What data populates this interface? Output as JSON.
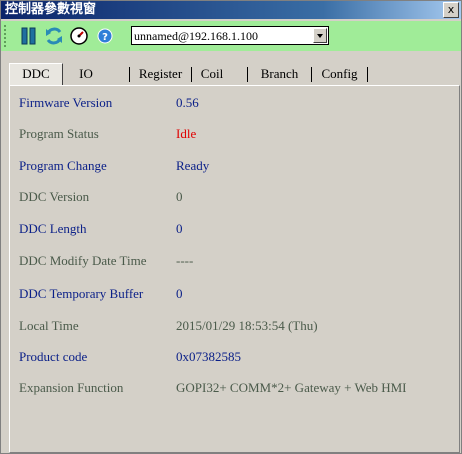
{
  "window": {
    "title": "控制器參數視窗",
    "close_label": "x"
  },
  "toolbar": {
    "icons": [
      "pause-icon",
      "refresh-icon",
      "gauge-icon",
      "help-icon"
    ],
    "connection": {
      "selected": "unnamed@192.168.1.100"
    }
  },
  "tabs": [
    {
      "label": "DDC"
    },
    {
      "label": "IO"
    },
    {
      "label": "Register"
    },
    {
      "label": "Coil"
    },
    {
      "label": "Branch"
    },
    {
      "label": "Config"
    }
  ],
  "fields": [
    {
      "label": "Firmware Version",
      "value": "0.56",
      "label_color": "blue",
      "value_color": "dark"
    },
    {
      "label": "Program Status",
      "value": "Idle",
      "label_color": "gray",
      "value_color": "red"
    },
    {
      "label": "Program Change",
      "value": "Ready",
      "label_color": "blue",
      "value_color": "dark"
    },
    {
      "label": "DDC Version",
      "value": "0",
      "label_color": "gray",
      "value_color": "gray"
    },
    {
      "label": "DDC Length",
      "value": "0",
      "label_color": "blue",
      "value_color": "dark"
    },
    {
      "label": "DDC Modify Date Time",
      "value": "----",
      "label_color": "gray",
      "value_color": "gray"
    },
    {
      "label": "DDC Temporary Buffer",
      "value": "0",
      "label_color": "blue",
      "value_color": "dark"
    },
    {
      "label": "Local Time",
      "value": "2015/01/29 18:53:54 (Thu)",
      "label_color": "gray",
      "value_color": "gray"
    },
    {
      "label": "Product code",
      "value": "0x07382585",
      "label_color": "blue",
      "value_color": "dark"
    },
    {
      "label": "Expansion Function",
      "value": "GOPI32+ COMM*2+ Gateway + Web HMI",
      "label_color": "gray",
      "value_color": "gray"
    }
  ],
  "colors": {
    "title_bar": "#0a246a",
    "toolbar": "#a0ec98",
    "label_blue": "#0a1f88",
    "label_gray": "#4a5a4a",
    "status_red": "#e00000"
  }
}
